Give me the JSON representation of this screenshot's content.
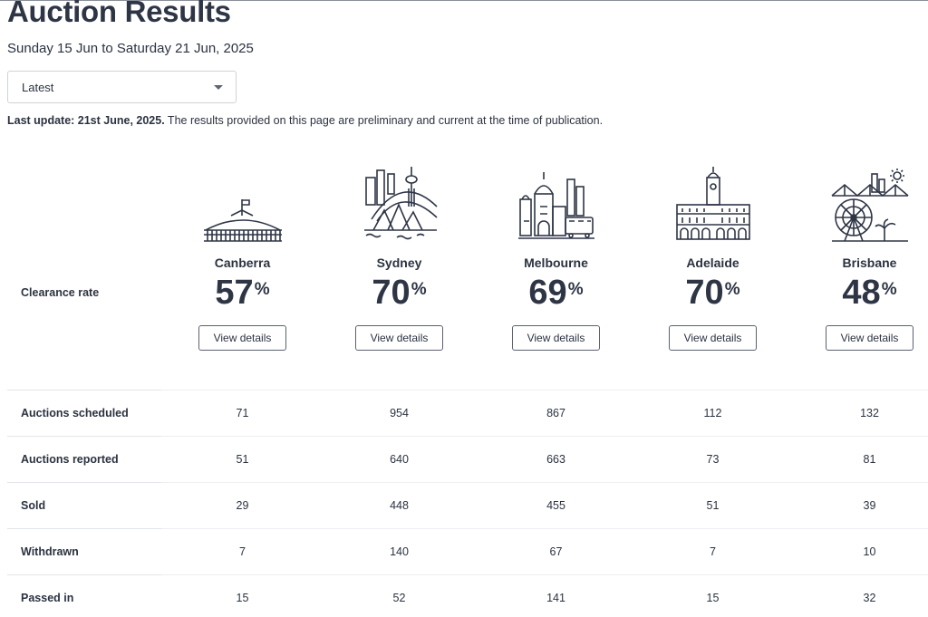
{
  "header": {
    "title": "Auction Results",
    "date_range": "Sunday 15 Jun to Saturday 21 Jun, 2025"
  },
  "filter": {
    "selected": "Latest"
  },
  "update": {
    "label": "Last update: 21st June, 2025.",
    "note": " The results provided on this page are preliminary and current at the time of publication."
  },
  "clearance_label": "Clearance rate",
  "view_details_label": "View details",
  "percent_symbol": "%",
  "cities": [
    {
      "name": "Canberra",
      "rate": "57",
      "icon": "canberra-parliament-icon"
    },
    {
      "name": "Sydney",
      "rate": "70",
      "icon": "sydney-opera-house-icon"
    },
    {
      "name": "Melbourne",
      "rate": "69",
      "icon": "melbourne-flinders-station-icon"
    },
    {
      "name": "Adelaide",
      "rate": "70",
      "icon": "adelaide-town-hall-icon"
    },
    {
      "name": "Brisbane",
      "rate": "48",
      "icon": "brisbane-story-bridge-icon"
    }
  ],
  "rows": [
    {
      "label": "Auctions scheduled",
      "values": [
        "71",
        "954",
        "867",
        "112",
        "132"
      ]
    },
    {
      "label": "Auctions reported",
      "values": [
        "51",
        "640",
        "663",
        "73",
        "81"
      ]
    },
    {
      "label": "Sold",
      "values": [
        "29",
        "448",
        "455",
        "51",
        "39"
      ]
    },
    {
      "label": "Withdrawn",
      "values": [
        "7",
        "140",
        "67",
        "7",
        "10"
      ]
    },
    {
      "label": "Passed in",
      "values": [
        "15",
        "52",
        "141",
        "15",
        "32"
      ]
    }
  ]
}
